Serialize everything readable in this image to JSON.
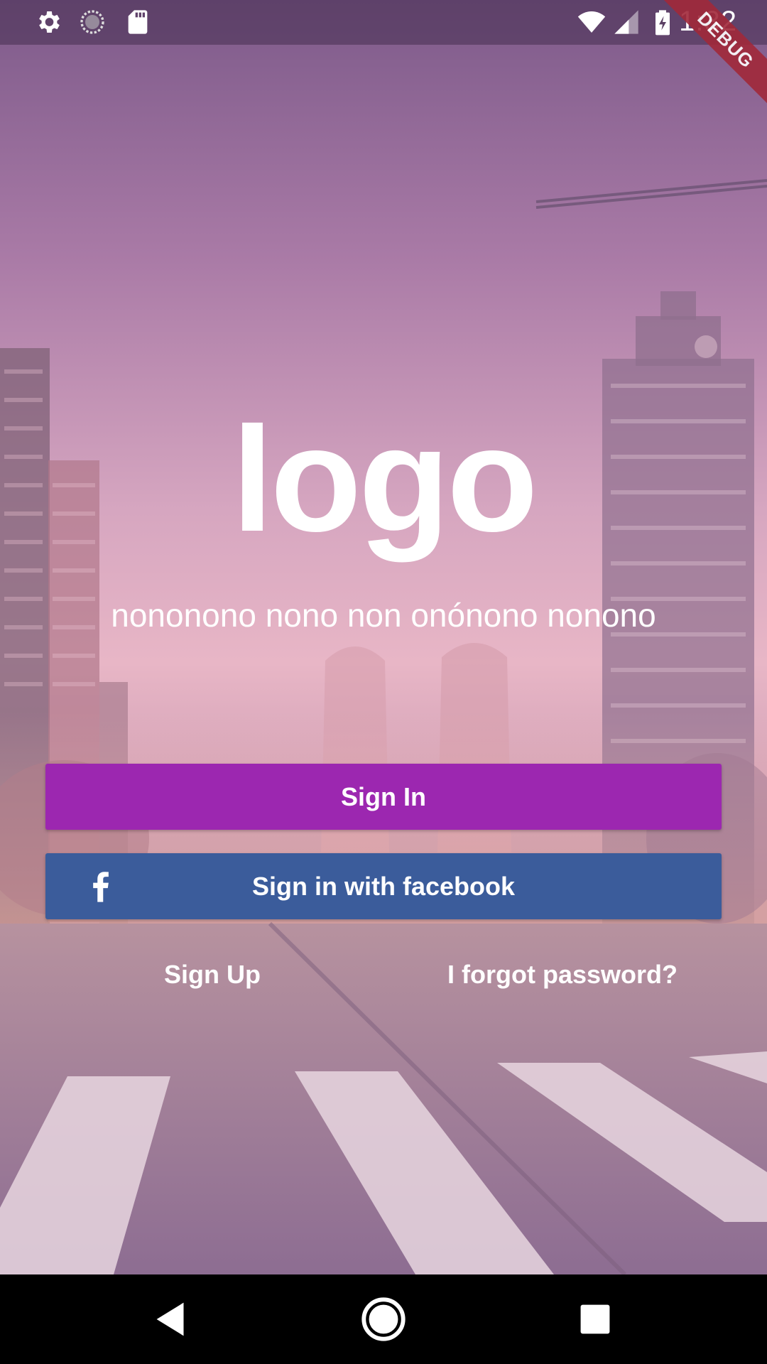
{
  "status_bar": {
    "time": "1:32",
    "left_icons": [
      "gear-icon",
      "sync-circle-icon",
      "sd-card-icon"
    ],
    "right_icons": [
      "wifi-icon",
      "signal-icon",
      "battery-charging-icon"
    ],
    "debug_banner": "DEBUG"
  },
  "main": {
    "logo_text": "logo",
    "tagline": "nononono nono non onónono nonono",
    "sign_in_label": "Sign In",
    "facebook_label": "Sign in with facebook",
    "sign_up_label": "Sign Up",
    "forgot_label": "I forgot password?"
  },
  "colors": {
    "sign_in_button": "#9c27b0",
    "facebook_button": "#3b5c9b",
    "debug_ribbon": "#a1293a"
  },
  "nav_bar": {
    "buttons": [
      "back-icon",
      "home-icon",
      "recents-icon"
    ]
  }
}
